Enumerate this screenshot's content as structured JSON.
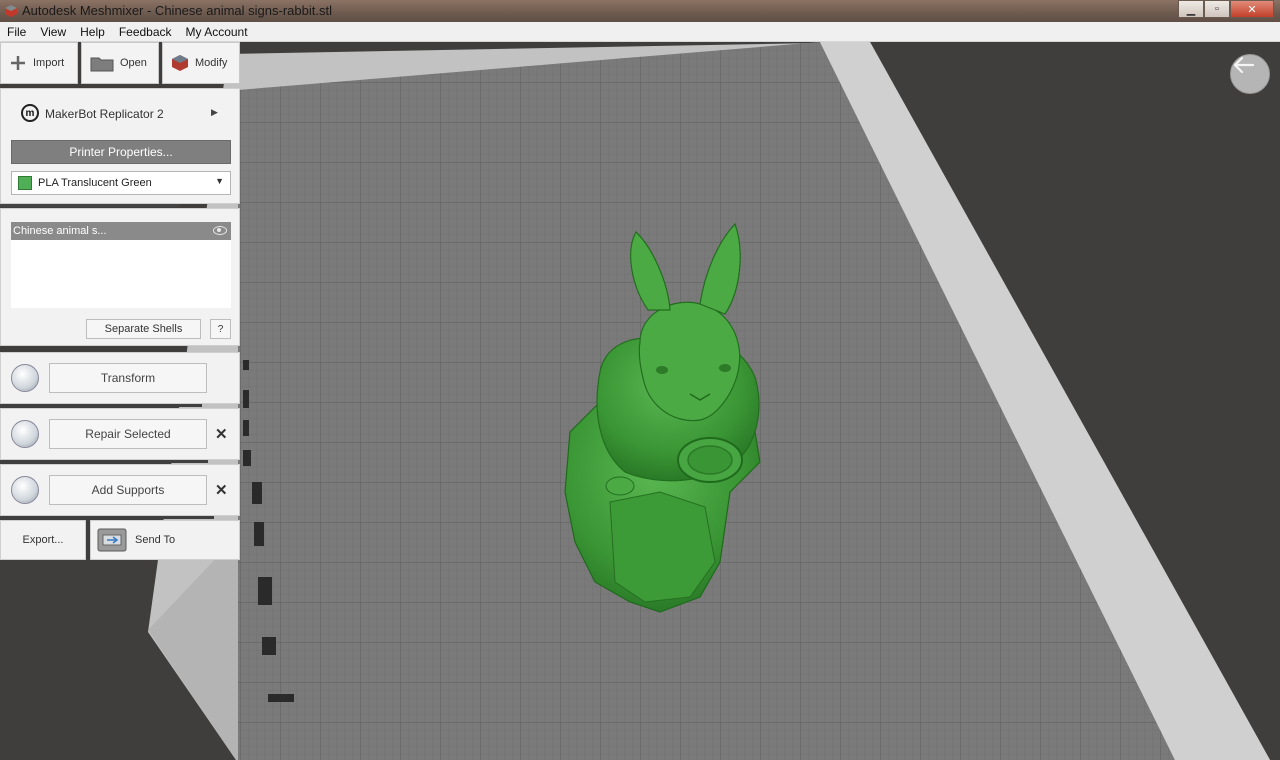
{
  "window": {
    "title": "Autodesk Meshmixer - Chinese animal signs-rabbit.stl",
    "controls": [
      "minimize",
      "maximize",
      "close"
    ]
  },
  "menu": [
    "File",
    "View",
    "Help",
    "Feedback",
    "My Account"
  ],
  "toolbar": {
    "import_label": "Import",
    "open_label": "Open",
    "modify_label": "Modify"
  },
  "printer": {
    "name": "MakerBot Replicator 2",
    "properties_label": "Printer Properties...",
    "material": "PLA Translucent Green",
    "material_color": "#4fae56"
  },
  "objects": {
    "items": [
      "Chinese animal s..."
    ],
    "separate_label": "Separate Shells",
    "help_label": "?"
  },
  "tools": {
    "transform_label": "Transform",
    "repair_label": "Repair Selected",
    "supports_label": "Add Supports"
  },
  "footer": {
    "export_label": "Export...",
    "send_label": "Send To"
  },
  "colors": {
    "model": "#3f9a3a",
    "bed_grid": "#777777",
    "bed_border": "#bfbfbf",
    "background": "#3f3e3c"
  }
}
